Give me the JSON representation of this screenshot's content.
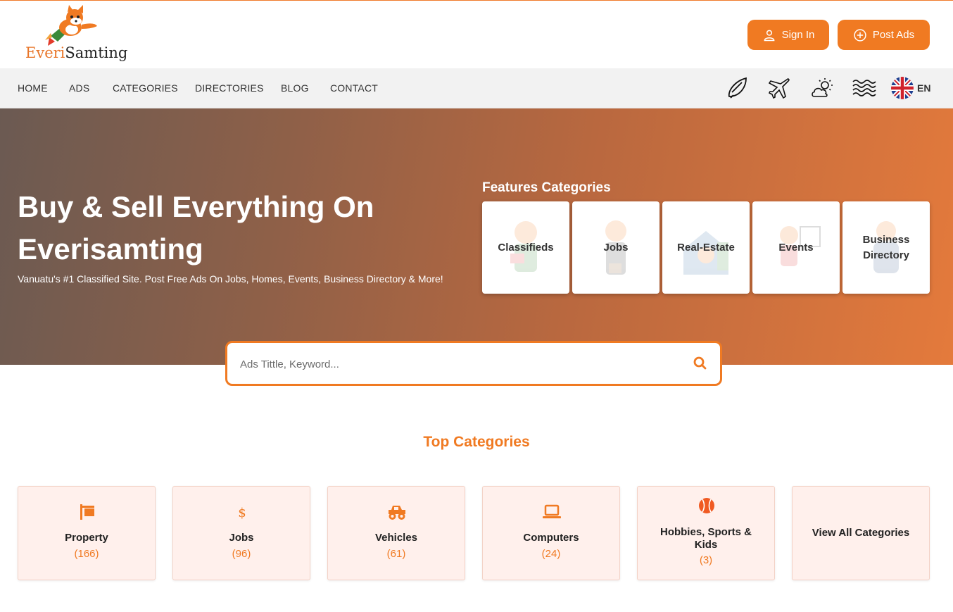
{
  "brand": {
    "logo_text_1": "Everi",
    "logo_text_2": "Samting",
    "accent": "#f07a22"
  },
  "header": {
    "signin_label": "Sign In",
    "post_label": "Post Ads"
  },
  "nav": {
    "items": [
      "HOME",
      "ADS",
      "CATEGORIES",
      "DIRECTORIES",
      "BLOG",
      "CONTACT"
    ],
    "icons": [
      "surfboard-icon",
      "airplane-icon",
      "weather-icon",
      "waves-icon"
    ],
    "lang": "EN"
  },
  "hero": {
    "title": "Buy & Sell Everything On Everisamting",
    "subtitle": "Vanuatu's #1 Classified Site. Post Free Ads On Jobs, Homes, Events, Business Directory & More!",
    "features_title": "Features Categories",
    "features": [
      "Classifieds",
      "Jobs",
      "Real-Estate",
      "Events",
      "Business Directory"
    ]
  },
  "search": {
    "placeholder": "Ads Tittle, Keyword..."
  },
  "top_categories": {
    "title": "Top Categories",
    "items": [
      {
        "name": "Property",
        "count": "(166)",
        "icon": "flag-sign-icon"
      },
      {
        "name": "Jobs",
        "count": "(96)",
        "icon": "dollar-icon"
      },
      {
        "name": "Vehicles",
        "count": "(61)",
        "icon": "monster-truck-icon"
      },
      {
        "name": "Computers",
        "count": "(24)",
        "icon": "laptop-icon"
      },
      {
        "name": "Hobbies, Sports & Kids",
        "count": "(3)",
        "icon": "ball-icon"
      }
    ],
    "view_all": "View All Categories"
  }
}
